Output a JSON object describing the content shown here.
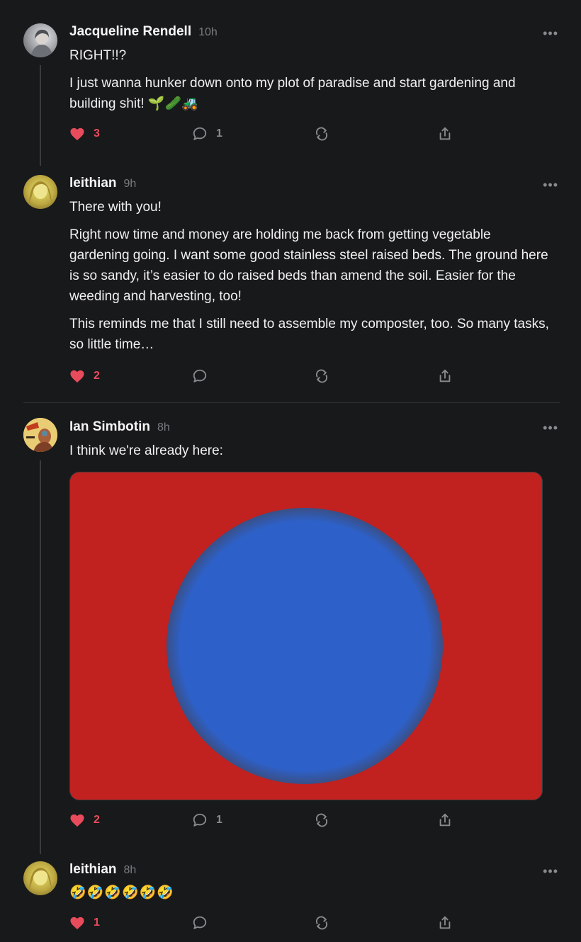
{
  "colors": {
    "background": "#18191b",
    "like": "#e84c5c",
    "muted": "#8a8b8f",
    "image_red": "#c1211f",
    "image_blue": "#2d61c9"
  },
  "icons": [
    "heart-icon",
    "comment-icon",
    "repost-icon",
    "share-icon",
    "more-icon"
  ],
  "posts": [
    {
      "author": "Jacqueline Rendell",
      "time": "10h",
      "paragraphs": [
        "RIGHT!!?",
        "I just wanna hunker down onto my plot of paradise and start gardening and building shit! 🌱🥒🚜"
      ],
      "likes": "3",
      "comments": "1"
    },
    {
      "author": "leithian",
      "time": "9h",
      "paragraphs": [
        "There with you!",
        "Right now time and money are holding me back from getting vegetable gardening going. I want some good stainless steel raised beds. The ground here is so sandy, it’s easier to do raised beds than amend the soil. Easier for the weeding and harvesting, too!",
        "This reminds me that I still need to assemble my composter, too. So many tasks, so little time…"
      ],
      "likes": "2",
      "comments": ""
    },
    {
      "author": "Ian Simbotin",
      "time": "8h",
      "paragraphs": [
        "I think we're already here:"
      ],
      "likes": "2",
      "comments": "1"
    },
    {
      "author": "leithian",
      "time": "8h",
      "paragraphs": [
        "🤣🤣🤣🤣🤣🤣"
      ],
      "likes": "1",
      "comments": ""
    }
  ]
}
